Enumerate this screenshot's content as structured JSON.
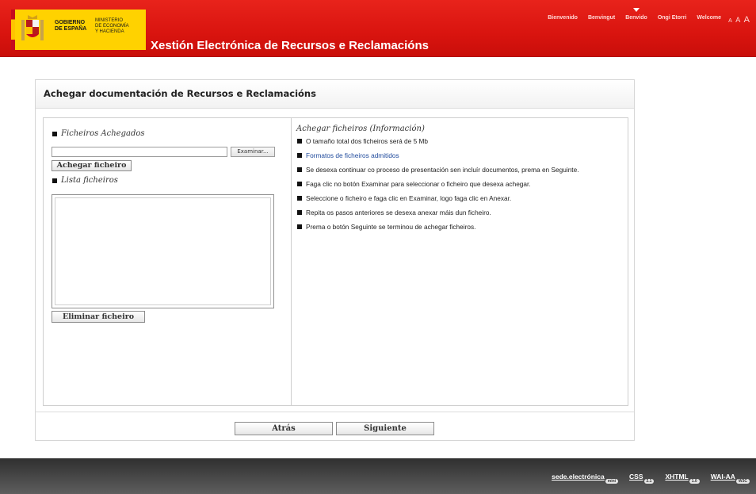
{
  "header": {
    "logo": {
      "gov_line1": "GOBIERNO",
      "gov_line2": "DE ESPAÑA",
      "ministry_line1": "MINISTERIO",
      "ministry_line2": "DE ECONOMÍA",
      "ministry_line3": "Y HACIENDA"
    },
    "site_title": "Xestión Electrónica de Recursos e Reclamacións",
    "languages": [
      "Bienvenido",
      "Benvingut",
      "Benvido",
      "Ongi Etorri",
      "Welcome"
    ],
    "active_language": "Benvido",
    "font_sizes": [
      "A",
      "A",
      "A"
    ],
    "brand_color": "#d9140f"
  },
  "panel": {
    "title": "Achegar documentación de Recursos e Reclamacións",
    "left": {
      "attached_label": "Ficheiros Achegados",
      "file_input_value": "",
      "browse_label": "Examinar...",
      "attach_button": "Achegar ficheiro",
      "list_label": "Lista ficheiros",
      "delete_button": "Eliminar ficheiro"
    },
    "right": {
      "info_title": "Achegar ficheiros (Información)",
      "items": [
        "O tamaño total dos ficheiros será de 5 Mb",
        "Formatos de ficheiros admitidos",
        "Se desexa continuar co proceso de presentación sen incluír documentos, prema en Seguinte.",
        "Faga clic no botón Examinar para seleccionar o ficheiro que desexa achegar.",
        "Seleccione o ficheiro e faga clic en Examinar, logo faga clic en Anexar.",
        "Repita os pasos anteriores se desexa anexar máis dun ficheiro.",
        "Prema o botón Seguinte se terminou de achegar ficheiros."
      ],
      "link_color": "#1f4a9c"
    },
    "footer": {
      "back_button": "Atrás",
      "next_button": "Siguiente"
    }
  },
  "footer": {
    "logos": [
      {
        "text": "sede.electrónica",
        "badge": "mini"
      },
      {
        "text": "CSS",
        "badge": "2.1"
      },
      {
        "text": "XHTML",
        "badge": "1.0"
      },
      {
        "text": "WAI-AA",
        "badge": "W3C"
      }
    ]
  }
}
